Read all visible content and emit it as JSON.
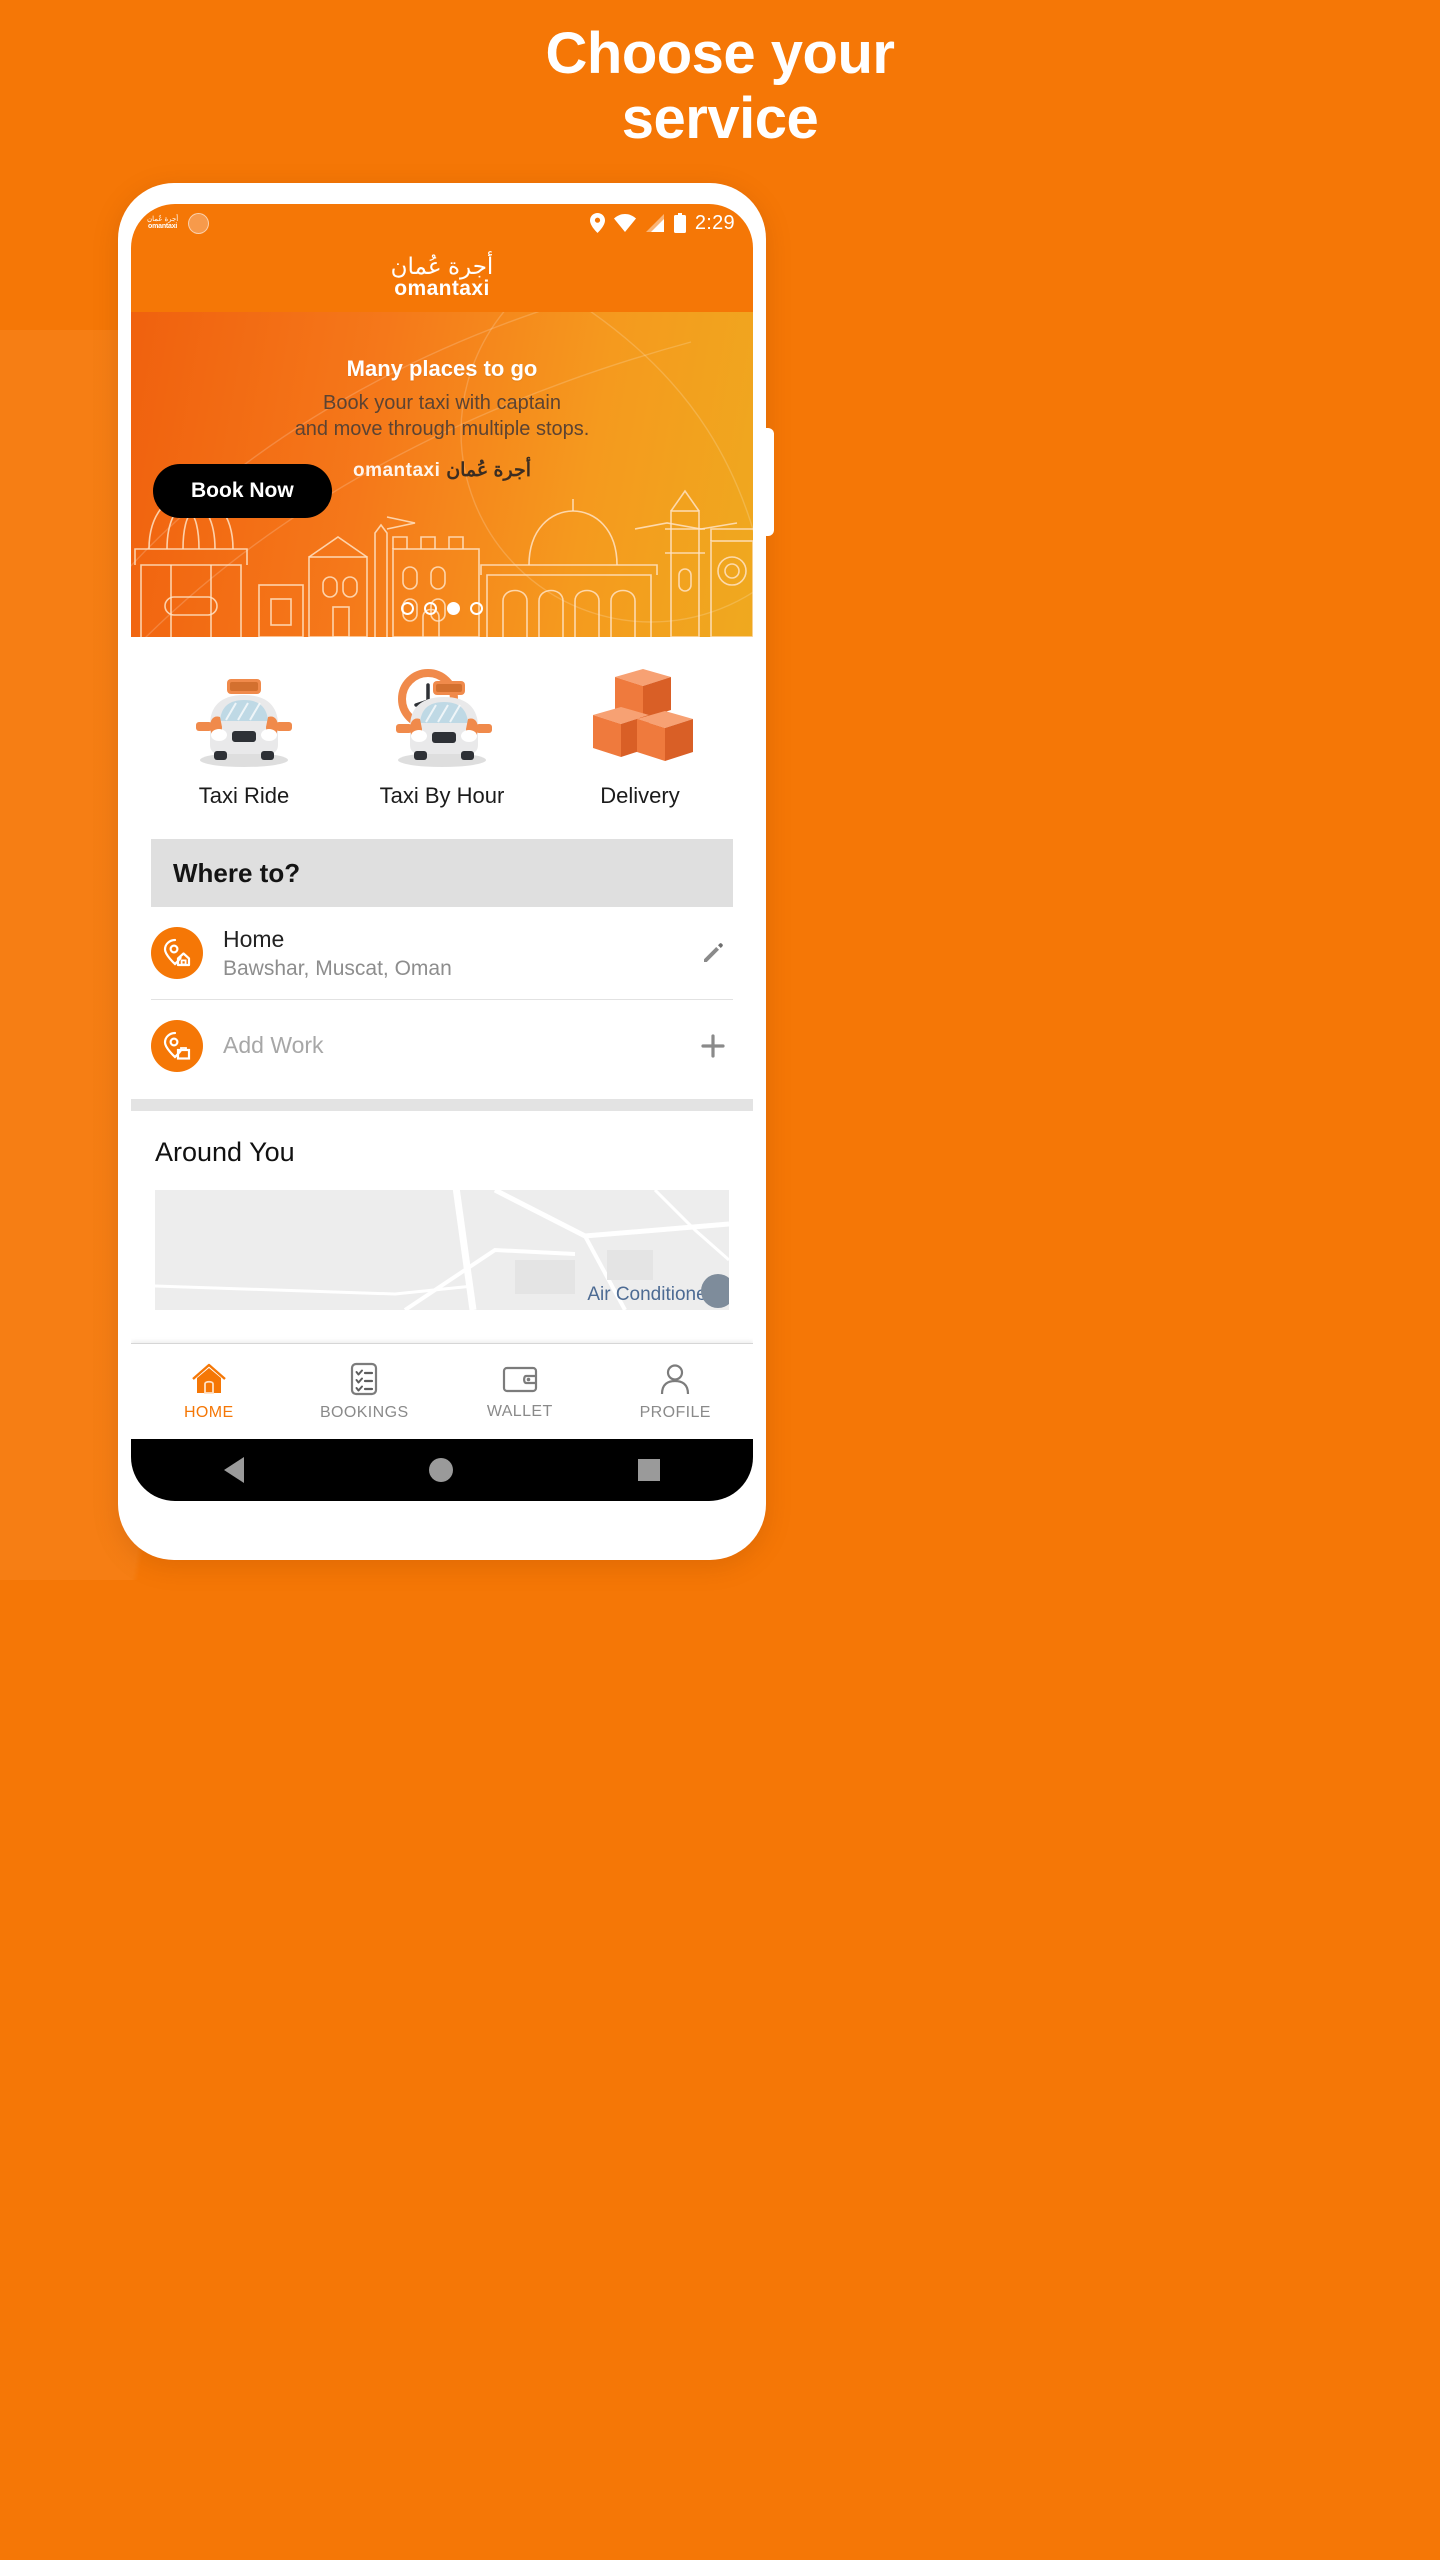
{
  "promo": {
    "headline_line1": "Choose your",
    "headline_line2": "service",
    "background_color": "#F57706"
  },
  "statusbar": {
    "logo_ar": "أجرة عُمان",
    "logo_en": "omantaxi",
    "time": "2:29",
    "icons": [
      "location-pin-icon",
      "wifi-icon",
      "signal-icon",
      "battery-icon"
    ]
  },
  "app_header": {
    "logo_ar": "أجرة عُمان",
    "logo_en": "omantaxi"
  },
  "banner": {
    "title": "Many places to go",
    "subtitle_line1": "Book your taxi with captain",
    "subtitle_line2": "and move through multiple stops.",
    "watermark_en": "omantaxi",
    "watermark_ar": "أجرة عُمان",
    "cta_label": "Book Now",
    "dots_total": 4,
    "dots_active_index": 2,
    "accent_color": "#F5781A"
  },
  "services": [
    {
      "label": "Taxi Ride",
      "icon": "taxi-car-icon"
    },
    {
      "label": "Taxi By Hour",
      "icon": "taxi-clock-icon"
    },
    {
      "label": "Delivery",
      "icon": "parcel-boxes-icon"
    }
  ],
  "whereto": {
    "label": "Where to?"
  },
  "addresses": [
    {
      "title": "Home",
      "subtitle": "Bawshar, Muscat, Oman",
      "icon": "home-pin-icon",
      "action": "edit-pencil-icon",
      "muted": false
    },
    {
      "title": "Add Work",
      "subtitle": "",
      "icon": "work-pin-icon",
      "action": "plus-icon",
      "muted": true
    }
  ],
  "around": {
    "title": "Around You",
    "map_label": "Air Conditioner"
  },
  "bottomnav": {
    "items": [
      {
        "label": "HOME",
        "icon": "home-icon",
        "active": true
      },
      {
        "label": "BOOKINGS",
        "icon": "checklist-icon",
        "active": false
      },
      {
        "label": "WALLET",
        "icon": "wallet-icon",
        "active": false
      },
      {
        "label": "PROFILE",
        "icon": "person-icon",
        "active": false
      }
    ],
    "active_color": "#F57706",
    "inactive_color": "#8A8A8A"
  },
  "sysbar": {
    "back": "back-triangle-icon",
    "home": "home-circle-icon",
    "recents": "recents-square-icon"
  }
}
